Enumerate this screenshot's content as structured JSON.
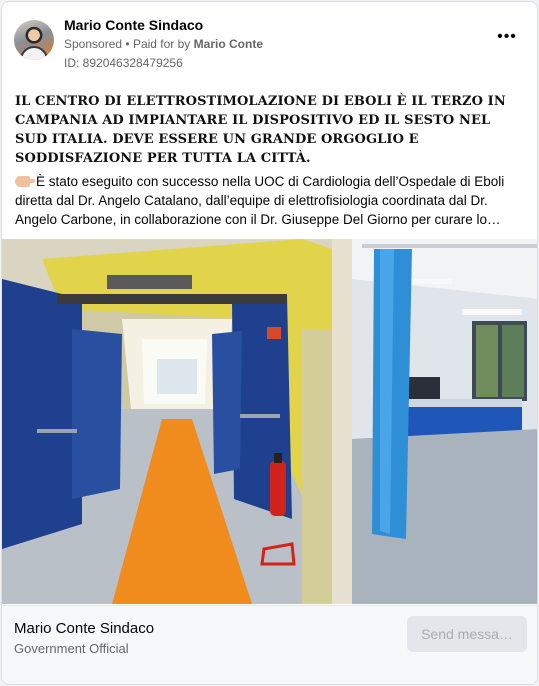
{
  "post": {
    "page_name": "Mario Conte Sindaco",
    "sponsored": "Sponsored",
    "separator": "•",
    "paid_prefix": "Paid for by",
    "paid_by": "Mario Conte",
    "ad_id": "ID: 892046328479256",
    "more_label": "•••",
    "headline": "IL CENTRO DI ELETTROSTIMOLAZIONE DI EBOLI È IL TERZO IN CAMPANIA AD IMPIANTARE IL DISPOSITIVO ED IL SESTO NEL SUD ITALIA. DEVE ESSERE UN GRANDE ORGOGLIO E SODDISFAZIONE PER TUTTA LA CITTÀ.",
    "body": "È stato eseguito con successo nella UOC di Cardiologia dell’Ospedale di Eboli diretta dal Dr. Angelo Catalano, dall’equipe di elettrofisiologia coordinata dal Dr. Angelo Carbone, in collaborazione con il Dr. Giuseppe Del Giorno per curare lo…",
    "hand_icon": "pointing-hand-icon"
  },
  "media": {
    "description_icon": "hospital-corridor-photo"
  },
  "footer": {
    "name": "Mario Conte Sindaco",
    "category": "Government Official",
    "cta_label": "Send messa…"
  },
  "colors": {
    "secondary_text": "#65676b",
    "cta_background": "#e4e6eb",
    "cta_text": "#a8abb0"
  }
}
